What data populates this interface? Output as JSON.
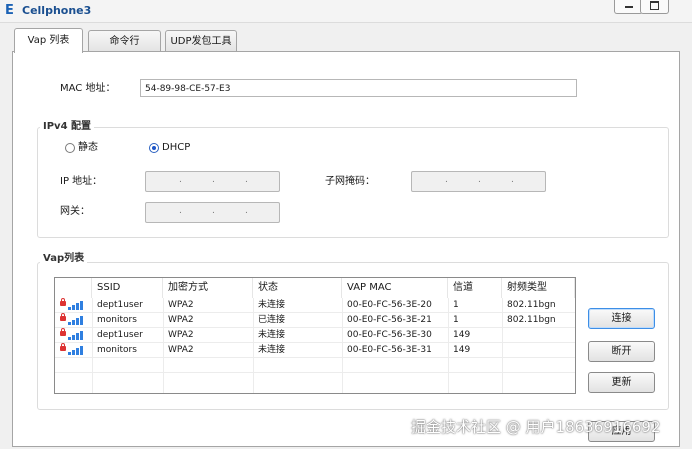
{
  "window": {
    "title": "Cellphone3",
    "app_icon": "E",
    "controls": [
      "minimize-icon",
      "maximize-icon"
    ]
  },
  "tabs": [
    {
      "label": "Vap 列表",
      "active": true
    },
    {
      "label": "命令行",
      "active": false
    },
    {
      "label": "UDP发包工具",
      "active": false
    }
  ],
  "mac": {
    "label": "MAC 地址：",
    "value": "54-89-98-CE-57-E3"
  },
  "ipv4": {
    "title": "IPv4 配置",
    "static_label": "静态",
    "dhcp_label": "DHCP",
    "selected": "DHCP",
    "ip_label": "IP 地址：",
    "mask_label": "子网掩码：",
    "gateway_label": "网关：",
    "ip_sep": "."
  },
  "vap": {
    "title": "Vap列表",
    "columns": [
      "SSID",
      "加密方式",
      "状态",
      "VAP MAC",
      "信道",
      "射频类型"
    ],
    "rows": [
      {
        "ssid": "dept1user",
        "enc": "WPA2",
        "status": "未连接",
        "mac": "00-E0-FC-56-3E-20",
        "channel": "1",
        "radio": "802.11bgn"
      },
      {
        "ssid": "monitors",
        "enc": "WPA2",
        "status": "已连接",
        "mac": "00-E0-FC-56-3E-21",
        "channel": "1",
        "radio": "802.11bgn"
      },
      {
        "ssid": "dept1user",
        "enc": "WPA2",
        "status": "未连接",
        "mac": "00-E0-FC-56-3E-30",
        "channel": "149",
        "radio": ""
      },
      {
        "ssid": "monitors",
        "enc": "WPA2",
        "status": "未连接",
        "mac": "00-E0-FC-56-3E-31",
        "channel": "149",
        "radio": ""
      }
    ],
    "row_icons": [
      "lock-icon",
      "signal-icon"
    ]
  },
  "buttons": {
    "connect": "连接",
    "disconnect": "断开",
    "refresh": "更新",
    "apply": "应用"
  },
  "watermark": "掘金技术社区 @ 用户18636916692",
  "colors": {
    "accent": "#3d8ee6",
    "signal": "#2f7fe0",
    "lock": "#d33333"
  }
}
